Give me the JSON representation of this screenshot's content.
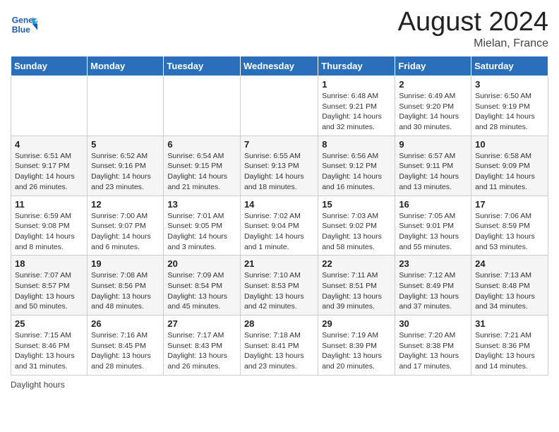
{
  "header": {
    "logo_text": "General Blue",
    "month_year": "August 2024",
    "location": "Mielan, France"
  },
  "days_of_week": [
    "Sunday",
    "Monday",
    "Tuesday",
    "Wednesday",
    "Thursday",
    "Friday",
    "Saturday"
  ],
  "weeks": [
    [
      {
        "day": "",
        "detail": ""
      },
      {
        "day": "",
        "detail": ""
      },
      {
        "day": "",
        "detail": ""
      },
      {
        "day": "",
        "detail": ""
      },
      {
        "day": "1",
        "detail": "Sunrise: 6:48 AM\nSunset: 9:21 PM\nDaylight: 14 hours and 32 minutes."
      },
      {
        "day": "2",
        "detail": "Sunrise: 6:49 AM\nSunset: 9:20 PM\nDaylight: 14 hours and 30 minutes."
      },
      {
        "day": "3",
        "detail": "Sunrise: 6:50 AM\nSunset: 9:19 PM\nDaylight: 14 hours and 28 minutes."
      }
    ],
    [
      {
        "day": "4",
        "detail": "Sunrise: 6:51 AM\nSunset: 9:17 PM\nDaylight: 14 hours and 26 minutes."
      },
      {
        "day": "5",
        "detail": "Sunrise: 6:52 AM\nSunset: 9:16 PM\nDaylight: 14 hours and 23 minutes."
      },
      {
        "day": "6",
        "detail": "Sunrise: 6:54 AM\nSunset: 9:15 PM\nDaylight: 14 hours and 21 minutes."
      },
      {
        "day": "7",
        "detail": "Sunrise: 6:55 AM\nSunset: 9:13 PM\nDaylight: 14 hours and 18 minutes."
      },
      {
        "day": "8",
        "detail": "Sunrise: 6:56 AM\nSunset: 9:12 PM\nDaylight: 14 hours and 16 minutes."
      },
      {
        "day": "9",
        "detail": "Sunrise: 6:57 AM\nSunset: 9:11 PM\nDaylight: 14 hours and 13 minutes."
      },
      {
        "day": "10",
        "detail": "Sunrise: 6:58 AM\nSunset: 9:09 PM\nDaylight: 14 hours and 11 minutes."
      }
    ],
    [
      {
        "day": "11",
        "detail": "Sunrise: 6:59 AM\nSunset: 9:08 PM\nDaylight: 14 hours and 8 minutes."
      },
      {
        "day": "12",
        "detail": "Sunrise: 7:00 AM\nSunset: 9:07 PM\nDaylight: 14 hours and 6 minutes."
      },
      {
        "day": "13",
        "detail": "Sunrise: 7:01 AM\nSunset: 9:05 PM\nDaylight: 14 hours and 3 minutes."
      },
      {
        "day": "14",
        "detail": "Sunrise: 7:02 AM\nSunset: 9:04 PM\nDaylight: 14 hours and 1 minute."
      },
      {
        "day": "15",
        "detail": "Sunrise: 7:03 AM\nSunset: 9:02 PM\nDaylight: 13 hours and 58 minutes."
      },
      {
        "day": "16",
        "detail": "Sunrise: 7:05 AM\nSunset: 9:01 PM\nDaylight: 13 hours and 55 minutes."
      },
      {
        "day": "17",
        "detail": "Sunrise: 7:06 AM\nSunset: 8:59 PM\nDaylight: 13 hours and 53 minutes."
      }
    ],
    [
      {
        "day": "18",
        "detail": "Sunrise: 7:07 AM\nSunset: 8:57 PM\nDaylight: 13 hours and 50 minutes."
      },
      {
        "day": "19",
        "detail": "Sunrise: 7:08 AM\nSunset: 8:56 PM\nDaylight: 13 hours and 48 minutes."
      },
      {
        "day": "20",
        "detail": "Sunrise: 7:09 AM\nSunset: 8:54 PM\nDaylight: 13 hours and 45 minutes."
      },
      {
        "day": "21",
        "detail": "Sunrise: 7:10 AM\nSunset: 8:53 PM\nDaylight: 13 hours and 42 minutes."
      },
      {
        "day": "22",
        "detail": "Sunrise: 7:11 AM\nSunset: 8:51 PM\nDaylight: 13 hours and 39 minutes."
      },
      {
        "day": "23",
        "detail": "Sunrise: 7:12 AM\nSunset: 8:49 PM\nDaylight: 13 hours and 37 minutes."
      },
      {
        "day": "24",
        "detail": "Sunrise: 7:13 AM\nSunset: 8:48 PM\nDaylight: 13 hours and 34 minutes."
      }
    ],
    [
      {
        "day": "25",
        "detail": "Sunrise: 7:15 AM\nSunset: 8:46 PM\nDaylight: 13 hours and 31 minutes."
      },
      {
        "day": "26",
        "detail": "Sunrise: 7:16 AM\nSunset: 8:45 PM\nDaylight: 13 hours and 28 minutes."
      },
      {
        "day": "27",
        "detail": "Sunrise: 7:17 AM\nSunset: 8:43 PM\nDaylight: 13 hours and 26 minutes."
      },
      {
        "day": "28",
        "detail": "Sunrise: 7:18 AM\nSunset: 8:41 PM\nDaylight: 13 hours and 23 minutes."
      },
      {
        "day": "29",
        "detail": "Sunrise: 7:19 AM\nSunset: 8:39 PM\nDaylight: 13 hours and 20 minutes."
      },
      {
        "day": "30",
        "detail": "Sunrise: 7:20 AM\nSunset: 8:38 PM\nDaylight: 13 hours and 17 minutes."
      },
      {
        "day": "31",
        "detail": "Sunrise: 7:21 AM\nSunset: 8:36 PM\nDaylight: 13 hours and 14 minutes."
      }
    ]
  ],
  "footer": {
    "daylight_label": "Daylight hours"
  }
}
